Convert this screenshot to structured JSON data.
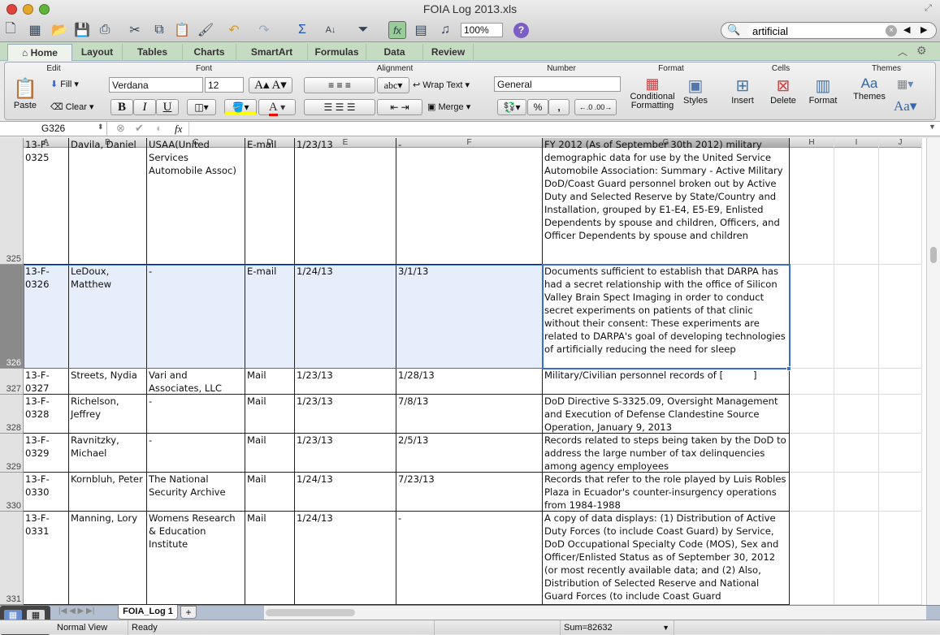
{
  "window": {
    "title": "FOIA Log 2013.xls"
  },
  "toolbar": {
    "zoom": "100%",
    "help": "?",
    "search_value": "artificial"
  },
  "ribbon_tabs": [
    "Home",
    "Layout",
    "Tables",
    "Charts",
    "SmartArt",
    "Formulas",
    "Data",
    "Review"
  ],
  "active_tab": "Home",
  "ribbon": {
    "groups": {
      "edit": "Edit",
      "font": "Font",
      "alignment": "Alignment",
      "number": "Number",
      "format": "Format",
      "cells": "Cells",
      "themes": "Themes"
    },
    "paste": "Paste",
    "fill": "Fill",
    "clear": "Clear",
    "font_name": "Verdana",
    "font_size": "12",
    "bold": "B",
    "italic": "I",
    "underline": "U",
    "wrap_text": "Wrap Text",
    "merge": "Merge",
    "abc": "abc",
    "number_format": "General",
    "percent": "%",
    "comma": ",",
    "conditional_formatting_1": "Conditional",
    "conditional_formatting_2": "Formatting",
    "styles": "Styles",
    "insert": "Insert",
    "delete": "Delete",
    "format": "Format",
    "themes": "Themes",
    "aa": "Aa",
    "colors": {
      "fill": "#ffff00",
      "font": "#ff0000"
    }
  },
  "formula_bar": {
    "name_box": "G326",
    "fx": "fx",
    "value": ""
  },
  "columns": [
    "A",
    "B",
    "C",
    "D",
    "E",
    "F",
    "G",
    "H",
    "I",
    "J"
  ],
  "rows": [
    {
      "num": "325",
      "cells": [
        "13-F-\n0325",
        "Davila, Daniel",
        "USAA(United Services Automobile Assoc)",
        "E-mail",
        "1/23/13",
        "-",
        "FY 2012 (As of September 30th 2012) military demographic data for use by the United Service Automobile Association: Summary - Active Military DoD/Coast Guard personnel broken out by Active Duty and Selected Reserve by State/Country and Installation, grouped by E1-E4, E5-E9, Enlisted Dependents by spouse and children, Officers, and Officer Dependents by spouse and children"
      ]
    },
    {
      "num": "326",
      "selected": true,
      "cells": [
        "13-F-\n0326",
        "LeDoux, Matthew",
        "-",
        "E-mail",
        "1/24/13",
        "3/1/13",
        "Documents sufficient to establish that DARPA has had a secret relationship with the office of Silicon Valley Brain Spect Imaging in order to conduct secret experiments on patients of that clinic without their consent: These experiments are related to DARPA's goal of developing technologies of artificially reducing the need for sleep"
      ]
    },
    {
      "num": "327",
      "cells": [
        "13-F-\n0327",
        "Streets, Nydia",
        "Vari and Associates, LLC",
        "Mail",
        "1/23/13",
        "1/28/13",
        "Military/Civilian personnel records of [          ]"
      ]
    },
    {
      "num": "328",
      "cells": [
        "13-F-\n0328",
        "Richelson, Jeffrey",
        "-",
        "Mail",
        "1/23/13",
        "7/8/13",
        "DoD Directive S-3325.09, Oversight Management and Execution of Defense Clandestine Source Operation, January 9, 2013"
      ]
    },
    {
      "num": "329",
      "cells": [
        "13-F-\n0329",
        "Ravnitzky, Michael",
        "-",
        "Mail",
        "1/23/13",
        "2/5/13",
        "Records related to steps being taken by the DoD to address the large number of tax delinquencies among agency employees"
      ]
    },
    {
      "num": "330",
      "cells": [
        "13-F-\n0330",
        "Kornbluh, Peter",
        "The National Security Archive",
        "Mail",
        "1/24/13",
        "7/23/13",
        "Records that refer to the role played by Luis Robles Plaza in Ecuador's counter-insurgency operations from 1984-1988"
      ]
    },
    {
      "num": "331",
      "cells": [
        "13-F-\n0331",
        "Manning, Lory",
        "Womens Research & Education Institute",
        "Mail",
        "1/24/13",
        "-",
        "A copy of data displays: (1) Distribution of Active Duty Forces (to include Coast Guard) by Service, DoD Occupational Specialty Code (MOS), Sex and Officer/Enlisted Status as of September 30, 2012 (or most recently available data; and (2) Also, Distribution of Selected Reserve and National Guard Forces (to include Coast Guard"
      ]
    }
  ],
  "sheet_tabs": [
    "FOIA_Log 1"
  ],
  "status": {
    "view": "Normal View",
    "state": "Ready",
    "sum": "Sum=82632"
  },
  "colors": {
    "selection": "#e5eefa",
    "selection_border": "#3a6fc4",
    "ribbon_tabs_bg": "#c5dcc2"
  }
}
